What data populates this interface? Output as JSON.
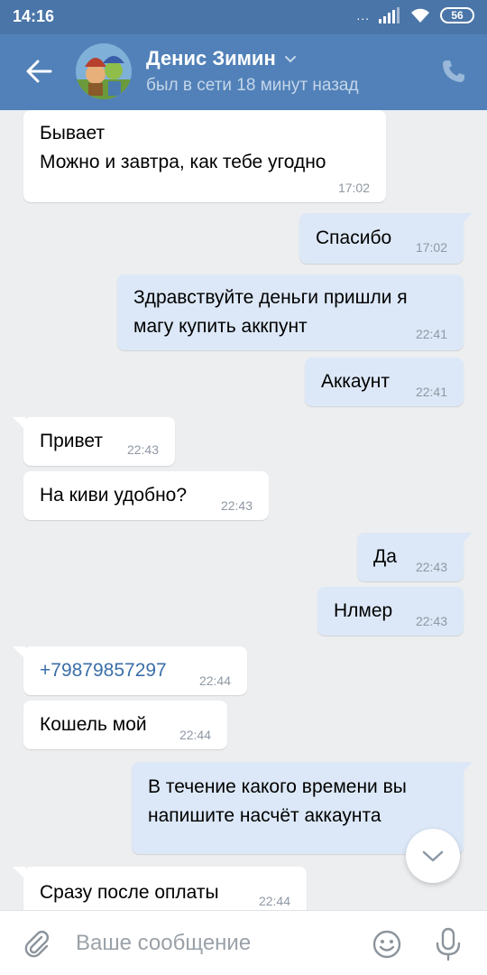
{
  "status_bar": {
    "time": "14:16",
    "dots": "...",
    "battery": "56"
  },
  "header": {
    "name": "Денис Зимин",
    "status": "был в сети 18 минут назад"
  },
  "messages": [
    {
      "text": "Бывает\nМожно и завтра, как тебе угодно",
      "time": "17:02"
    },
    {
      "text": "Спасибо",
      "time": "17:02"
    },
    {
      "text": "Здравствуйте деньги пришли я\nмагу купить аккпунт",
      "time": "22:41"
    },
    {
      "text": "Аккаунт",
      "time": "22:41"
    },
    {
      "text": "Привет",
      "time": "22:43"
    },
    {
      "text": "На киви удобно?",
      "time": "22:43"
    },
    {
      "text": "Да",
      "time": "22:43"
    },
    {
      "text": "Нлмер",
      "time": "22:43"
    },
    {
      "text": "+79879857297",
      "time": "22:44"
    },
    {
      "text": "Кошель мой",
      "time": "22:44"
    },
    {
      "text": "В течение какого времени вы\nнапишите насчёт аккаунта",
      "time": ""
    },
    {
      "text": "Сразу после оплаты",
      "time": "22:44"
    }
  ],
  "input": {
    "placeholder": "Ваше сообщение"
  }
}
